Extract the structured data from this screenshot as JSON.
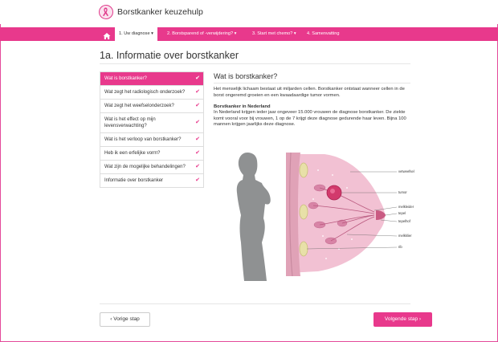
{
  "app": {
    "title": "Borstkanker keuzehulp"
  },
  "nav": {
    "items": [
      {
        "label": "1. Uw diagnose",
        "active": true
      },
      {
        "label": "2. Borstsparend of -verwijdering?",
        "active": false
      },
      {
        "label": "3. Start met chemo?",
        "active": false
      },
      {
        "label": "4. Samenvatting",
        "active": false
      }
    ]
  },
  "page": {
    "title": "1a. Informatie over borstkanker"
  },
  "sidebar": {
    "items": [
      {
        "label": "Wat is borstkanker?",
        "active": true,
        "checked": true
      },
      {
        "label": "Wat zegt het radiologisch onderzoek?",
        "active": false,
        "checked": true
      },
      {
        "label": "Wat zegt het weefselonderzoek?",
        "active": false,
        "checked": true
      },
      {
        "label": "Wat is het effect op mijn levensverwachting?",
        "active": false,
        "checked": true
      },
      {
        "label": "Wat is het verloop van borstkanker?",
        "active": false,
        "checked": true
      },
      {
        "label": "Heb ik een erfelijke vorm?",
        "active": false,
        "checked": true
      },
      {
        "label": "Wat zijn de mogelijke behandelingen?",
        "active": false,
        "checked": true
      },
      {
        "label": "Informatie over borstkanker",
        "active": false,
        "checked": true
      }
    ]
  },
  "content": {
    "title": "Wat is borstkanker?",
    "intro": "Het menselijk lichaam bestaat uit miljarden cellen. Borstkanker ontstaat wanneer cellen in de borst ongeremd groeien en een kwaadaardige tumor vormen.",
    "subhead": "Borstkanker in Nederland",
    "body": "In Nederland krijgen ieder jaar ongeveer 15.000 vrouwen de diagnose borstkanker. De ziekte komt vooral voor bij vrouwen, 1 op de 7 krijgt deze diagnose gedurende haar leven. Bijna 100 mannen krijgen jaarlijks deze diagnose.",
    "annotations": [
      "vetweefsel",
      "tumor",
      "melkleider",
      "tepel",
      "tepelhof",
      "melkklier",
      "rib"
    ]
  },
  "footer": {
    "prev_label": "Vorige stap",
    "next_label": "Volgende stap"
  },
  "colors": {
    "brand": "#e8398c"
  }
}
